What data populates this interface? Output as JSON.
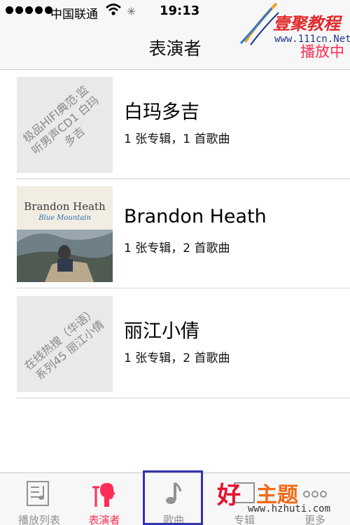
{
  "status_bar": {
    "carrier": "中国联通",
    "time": "19:13"
  },
  "nav": {
    "title": "表演者",
    "right_button": "播放中"
  },
  "artists": [
    {
      "name": "白玛多吉",
      "meta": "1 张专辑，1 首歌曲",
      "art_text": "极品HIFI典范·监听男声CD1 白玛多吉"
    },
    {
      "name": "Brandon Heath",
      "meta": "1 张专辑，2 首歌曲",
      "art_title": "Brandon Heath",
      "art_subtitle": "Blue Mountain"
    },
    {
      "name": "丽江小倩",
      "meta": "1 张专辑，2 首歌曲",
      "art_text": "在线热搜（华语）系列45 丽江小倩"
    }
  ],
  "tabs": [
    {
      "label": "播放列表",
      "icon": "playlist-icon",
      "active": false
    },
    {
      "label": "表演者",
      "icon": "artist-icon",
      "active": true
    },
    {
      "label": "歌曲",
      "icon": "music-note-icon",
      "active": false
    },
    {
      "label": "专辑",
      "icon": "album-icon",
      "active": false
    },
    {
      "label": "更多",
      "icon": "more-icon",
      "active": false
    }
  ],
  "watermarks": {
    "top_title": "壹聚教程",
    "top_url": "www.111cn.Net",
    "bottom_title_a": "好",
    "bottom_title_b": "主题",
    "bottom_url": "www.hzhuti.com"
  },
  "colors": {
    "accent": "#ff2d55",
    "tab_inactive": "#929292",
    "highlight_box": "#3333aa"
  }
}
